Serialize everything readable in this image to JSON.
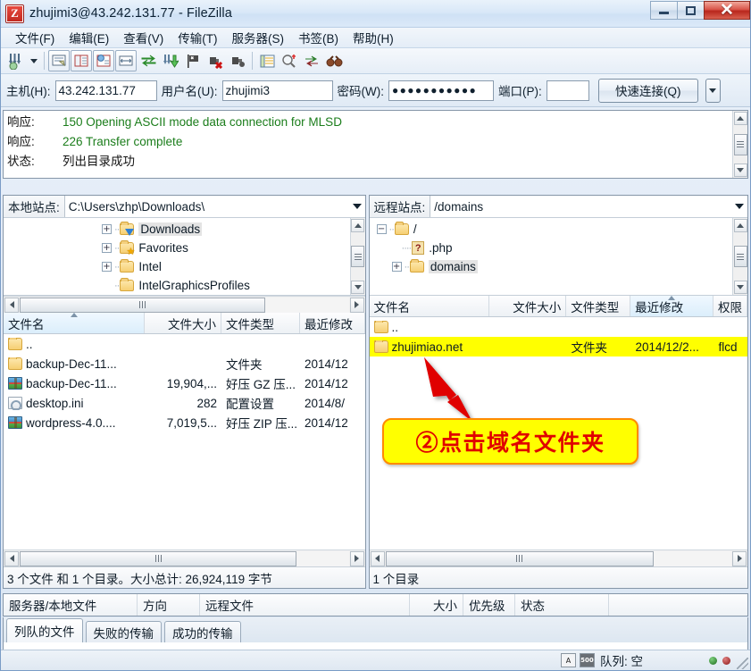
{
  "window": {
    "title": "zhujimi3@43.242.131.77 - FileZilla",
    "logo_text": "Z",
    "minimize_label": "",
    "maximize_label": "",
    "close_label": "✕"
  },
  "menubar": {
    "items": [
      {
        "label": "文件(F)"
      },
      {
        "label": "编辑(E)"
      },
      {
        "label": "查看(V)"
      },
      {
        "label": "传输(T)"
      },
      {
        "label": "服务器(S)"
      },
      {
        "label": "书签(B)"
      },
      {
        "label": "帮助(H)"
      }
    ]
  },
  "toolbar": {
    "items": [
      {
        "name": "site-manager-icon",
        "glyph": "⤓"
      },
      {
        "name": "site-manager-dropdown-icon",
        "glyph": ""
      },
      {
        "name": "toggle-message-log-icon",
        "glyph": "▤"
      },
      {
        "name": "toggle-local-tree-icon",
        "glyph": "▥"
      },
      {
        "name": "toggle-remote-tree-icon",
        "glyph": "▦"
      },
      {
        "name": "toggle-transfer-queue-icon",
        "glyph": "▧"
      },
      {
        "name": "refresh-icon",
        "glyph": "⇄"
      },
      {
        "name": "process-queue-icon",
        "glyph": "⇊"
      },
      {
        "name": "cancel-operation-icon",
        "glyph": "⚑"
      },
      {
        "name": "disconnect-icon",
        "glyph": "✖"
      },
      {
        "name": "reconnect-icon",
        "glyph": "⛓"
      },
      {
        "name": "filter-icon",
        "glyph": "☰"
      },
      {
        "name": "directory-compare-icon",
        "glyph": "🔍"
      },
      {
        "name": "synchronized-browsing-icon",
        "glyph": "⇅"
      },
      {
        "name": "find-files-icon",
        "glyph": "👓"
      }
    ]
  },
  "quickconnect": {
    "host_label": "主机(H):",
    "host_value": "43.242.131.77",
    "user_label": "用户名(U):",
    "user_value": "zhujimi3",
    "pass_label": "密码(W):",
    "pass_value": "●●●●●●●●●●●",
    "port_label": "端口(P):",
    "port_value": "",
    "port_placeholder": "",
    "connect_label": "快速连接(Q)",
    "dropdown_glyph": "▾"
  },
  "messagelog": {
    "rows": [
      {
        "key": "响应:",
        "text": "150 Opening ASCII mode data connection for MLSD",
        "kind": "response"
      },
      {
        "key": "响应:",
        "text": "226 Transfer complete",
        "kind": "response"
      },
      {
        "key": "状态:",
        "text": "列出目录成功",
        "kind": "status"
      }
    ]
  },
  "local": {
    "site_label": "本地站点:",
    "site_path": "C:\\Users\\zhp\\Downloads\\",
    "tree": [
      {
        "label": "Downloads",
        "expander": "+",
        "icon": "folder-download-icon",
        "selected": true
      },
      {
        "label": "Favorites",
        "expander": "+",
        "icon": "folder-favorites-icon",
        "selected": false
      },
      {
        "label": "Intel",
        "expander": "+",
        "icon": "folder-icon",
        "selected": false
      },
      {
        "label": "IntelGraphicsProfiles",
        "expander": "",
        "icon": "folder-icon",
        "selected": false
      }
    ],
    "columns": [
      {
        "label": "文件名",
        "sorted": true
      },
      {
        "label": "文件大小",
        "sorted": false
      },
      {
        "label": "文件类型",
        "sorted": false
      },
      {
        "label": "最近修改",
        "sorted": false
      }
    ],
    "rows": [
      {
        "name": "..",
        "size": "",
        "type": "",
        "modified": "",
        "icon": "folder-icon"
      },
      {
        "name": "backup-Dec-11...",
        "size": "",
        "type": "文件夹",
        "modified": "2014/12",
        "icon": "folder-icon"
      },
      {
        "name": "backup-Dec-11...",
        "size": "19,904,...",
        "type": "好压 GZ 压...",
        "modified": "2014/12",
        "icon": "archive-icon"
      },
      {
        "name": "desktop.ini",
        "size": "282",
        "type": "配置设置",
        "modified": "2014/8/",
        "icon": "ini-icon"
      },
      {
        "name": "wordpress-4.0....",
        "size": "7,019,5...",
        "type": "好压 ZIP 压...",
        "modified": "2014/12",
        "icon": "archive-icon"
      }
    ],
    "status": "3 个文件 和 1 个目录。大小总计: 26,924,119 字节"
  },
  "remote": {
    "site_label": "远程站点:",
    "site_path": "/domains",
    "tree": [
      {
        "label": "/",
        "expander": "-",
        "icon": "folder-icon",
        "selected": false
      },
      {
        "label": ".php",
        "expander": "",
        "icon": "unknown-file-icon",
        "selected": false
      },
      {
        "label": "domains",
        "expander": "+",
        "icon": "folder-icon",
        "selected": true
      }
    ],
    "columns": [
      {
        "label": "文件名",
        "sorted": false
      },
      {
        "label": "文件大小",
        "sorted": false
      },
      {
        "label": "文件类型",
        "sorted": false
      },
      {
        "label": "最近修改",
        "sorted": true
      },
      {
        "label": "权限",
        "sorted": false
      }
    ],
    "rows": [
      {
        "name": "..",
        "size": "",
        "type": "",
        "modified": "",
        "perms": "",
        "icon": "folder-icon",
        "highlighted": false
      },
      {
        "name": "zhujimiao.net",
        "size": "",
        "type": "文件夹",
        "modified": "2014/12/2...",
        "perms": "flcd",
        "icon": "folder-icon",
        "highlighted": true
      }
    ],
    "status": "1 个目录"
  },
  "queue": {
    "columns": [
      {
        "label": "服务器/本地文件"
      },
      {
        "label": "方向"
      },
      {
        "label": "远程文件"
      },
      {
        "label": "大小"
      },
      {
        "label": "优先级"
      },
      {
        "label": "状态"
      }
    ],
    "tabs": [
      {
        "label": "列队的文件",
        "active": true
      },
      {
        "label": "失败的传输",
        "active": false
      },
      {
        "label": "成功的传输",
        "active": false
      }
    ]
  },
  "statusbar": {
    "queue_text": "队列: 空",
    "icon_ascii": "A",
    "icon_speed": "500"
  },
  "annotation": {
    "text": "②点击域名文件夹",
    "box_color": "#ffff00",
    "border_color": "#ff8a00",
    "text_color": "#e00000",
    "arrow_color": "#e00000"
  }
}
